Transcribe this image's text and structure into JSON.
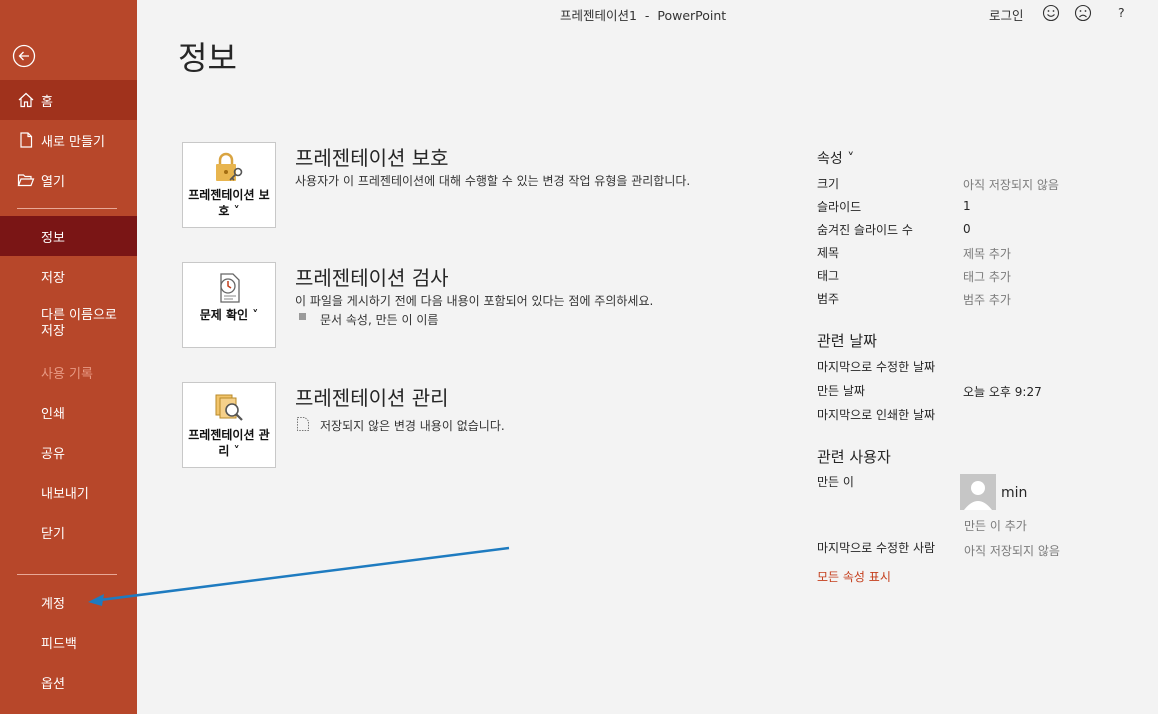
{
  "window": {
    "title": "프레젠테이션1  -  PowerPoint",
    "sign_in": "로그인",
    "help": "?"
  },
  "sidebar": {
    "items": [
      {
        "label": "홈"
      },
      {
        "label": "새로 만들기"
      },
      {
        "label": "열기"
      },
      {
        "label": "정보"
      },
      {
        "label": "저장"
      },
      {
        "label": "다른 이름으로 저장"
      },
      {
        "label": "사용 기록"
      },
      {
        "label": "인쇄"
      },
      {
        "label": "공유"
      },
      {
        "label": "내보내기"
      },
      {
        "label": "닫기"
      },
      {
        "label": "계정"
      },
      {
        "label": "피드백"
      },
      {
        "label": "옵션"
      }
    ]
  },
  "page_title": "정보",
  "sections": [
    {
      "card_label": "프레젠테이션 보호 ˅",
      "title": "프레젠테이션 보호",
      "desc": "사용자가 이 프레젠테이션에 대해 수행할 수 있는 변경 작업 유형을 관리합니다."
    },
    {
      "card_label": "문제 확인 ˅",
      "title": "프레젠테이션 검사",
      "desc": "이 파일을 게시하기 전에 다음 내용이 포함되어 있다는 점에 주의하세요.",
      "sub": "문서 속성, 만든 이 이름"
    },
    {
      "card_label": "프레젠테이션 관리 ˅",
      "title": "프레젠테이션 관리",
      "sub": "저장되지 않은 변경 내용이 없습니다."
    }
  ],
  "properties": {
    "heading": "속성 ˅",
    "rows": [
      {
        "label": "크기",
        "value": "아직 저장되지 않음"
      },
      {
        "label": "슬라이드",
        "value": "1"
      },
      {
        "label": "숨겨진 슬라이드 수",
        "value": "0"
      },
      {
        "label": "제목",
        "value": "제목 추가"
      },
      {
        "label": "태그",
        "value": "태그 추가"
      },
      {
        "label": "범주",
        "value": "범주 추가"
      }
    ]
  },
  "dates": {
    "heading": "관련 날짜",
    "rows": [
      {
        "label": "마지막으로 수정한 날짜",
        "value": ""
      },
      {
        "label": "만든 날짜",
        "value": "오늘 오후 9:27"
      },
      {
        "label": "마지막으로 인쇄한 날짜",
        "value": ""
      }
    ]
  },
  "people": {
    "heading": "관련 사용자",
    "author_label": "만든 이",
    "author_name": "min",
    "add_author": "만든 이 추가",
    "last_modified_label": "마지막으로 수정한 사람",
    "last_modified_value": "아직 저장되지 않음"
  },
  "show_all": "모든 속성 표시",
  "colors": {
    "sidebar": "#b7472a",
    "sidebar_active": "#7a1515",
    "link": "#c43e1c",
    "annotation_arrow": "#1e7bc0"
  }
}
